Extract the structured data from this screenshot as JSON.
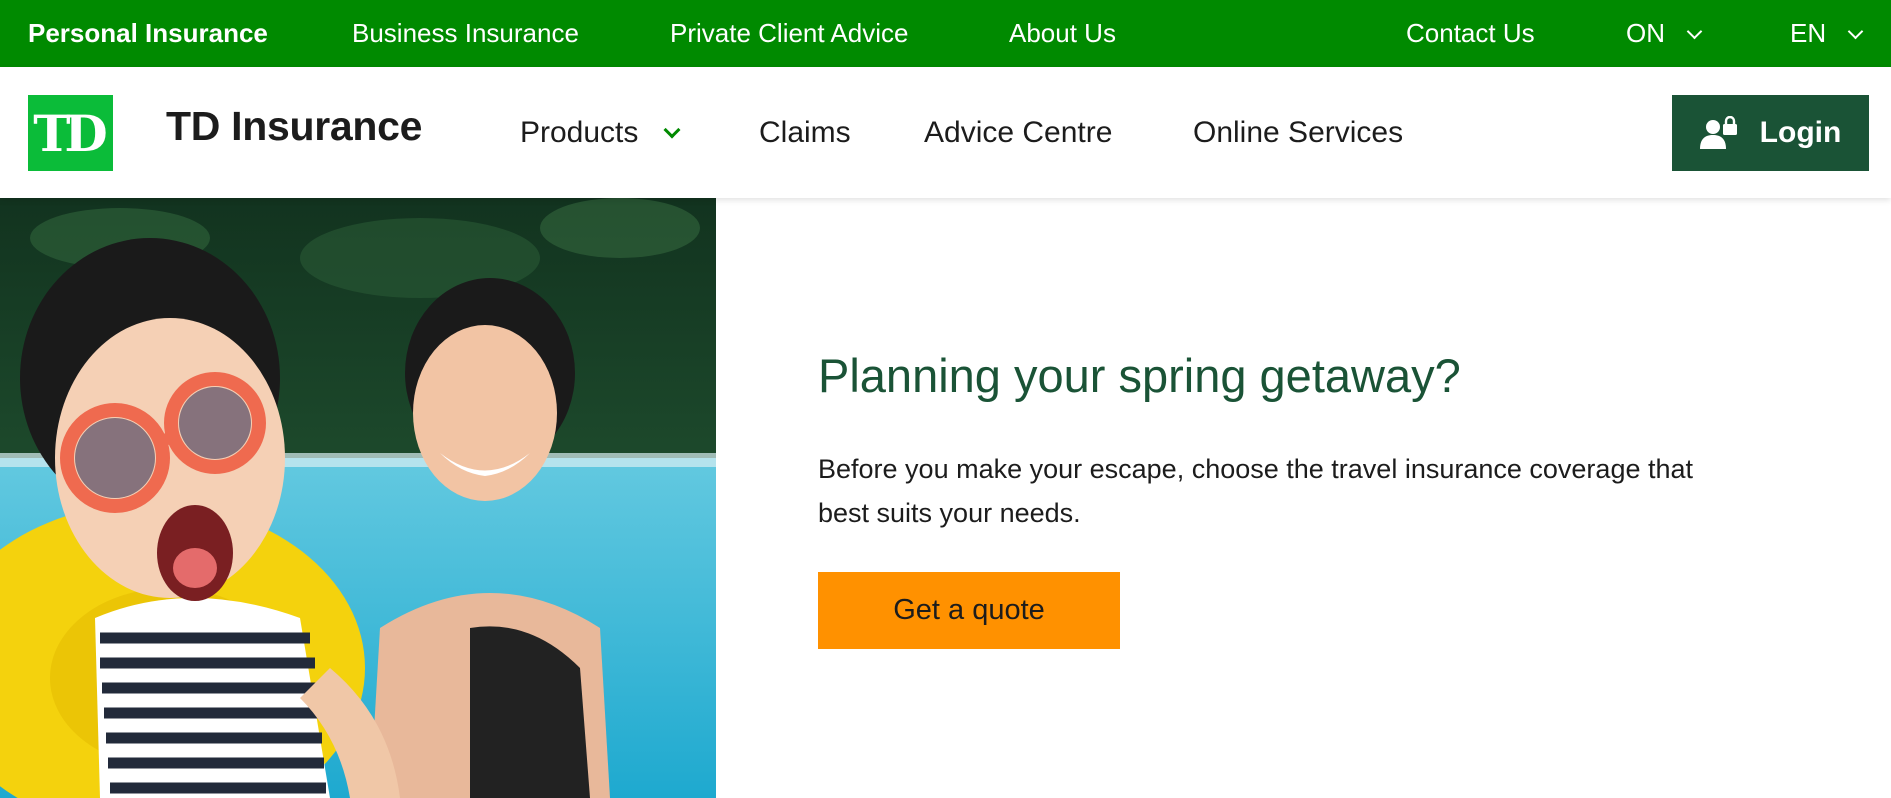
{
  "topbar": {
    "links": [
      "Personal Insurance",
      "Business Insurance",
      "Private Client Advice",
      "About Us"
    ],
    "contact": "Contact Us",
    "province": "ON",
    "language": "EN"
  },
  "header": {
    "logo_text": "TD",
    "brand": "TD Insurance",
    "nav": [
      "Products",
      "Claims",
      "Advice Centre",
      "Online Services"
    ],
    "login": "Login"
  },
  "hero": {
    "headline": "Planning your spring getaway?",
    "body": "Before you make your escape, choose the travel insurance coverage that best suits your needs.",
    "cta": "Get a quote"
  },
  "colors": {
    "topbar": "#008a00",
    "logo": "#0bbc39",
    "login_button": "#1a5336",
    "headline": "#1a5336",
    "cta": "#ff9100"
  }
}
